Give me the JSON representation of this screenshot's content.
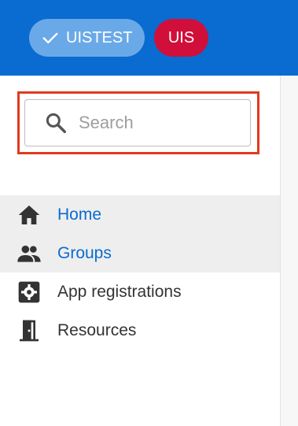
{
  "header": {
    "environment_chip": {
      "label": "UISTEST",
      "icon": "check-icon",
      "color": "#6aa9e8"
    },
    "user_chip": {
      "label": "UIS",
      "color": "#d0103a"
    },
    "background": "#0a6bd1"
  },
  "search": {
    "placeholder": "Search",
    "value": "",
    "icon": "search-icon",
    "highlight_color": "#e03a1e"
  },
  "nav": {
    "items": [
      {
        "label": "Home",
        "icon": "home-icon",
        "style": "link",
        "shaded": true
      },
      {
        "label": "Groups",
        "icon": "groups-icon",
        "style": "link",
        "shaded": true
      },
      {
        "label": "App registrations",
        "icon": "gear-box-icon",
        "style": "plain",
        "shaded": false
      },
      {
        "label": "Resources",
        "icon": "door-icon",
        "style": "plain",
        "shaded": false
      }
    ]
  }
}
